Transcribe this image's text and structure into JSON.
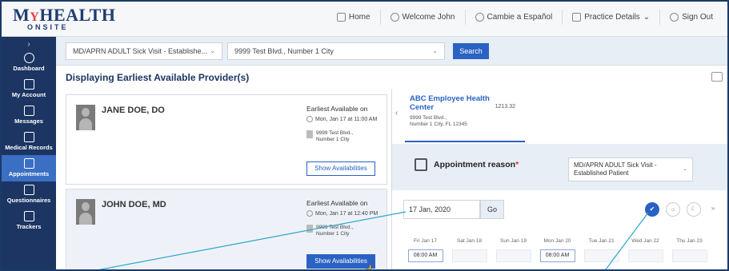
{
  "logo": {
    "main_m": "M",
    "main_y": "Y",
    "main_rest": "HEALTH",
    "sub": "ONSITE"
  },
  "nav": [
    {
      "label": "Home"
    },
    {
      "label": "Welcome John"
    },
    {
      "label": "Cambie a Español"
    },
    {
      "label": "Practice Details"
    },
    {
      "label": "Sign Out"
    }
  ],
  "sidebar": {
    "items": [
      {
        "label": "Dashboard"
      },
      {
        "label": "My Account"
      },
      {
        "label": "Messages"
      },
      {
        "label": "Medical Records"
      },
      {
        "label": "Appointments",
        "active": true
      },
      {
        "label": "Questionnaires"
      },
      {
        "label": "Trackers"
      }
    ]
  },
  "filters": {
    "visit_type": "MD/APRN ADULT Sick Visit - Establishe...",
    "location": "9999 Test Blvd., Number 1 City",
    "search_label": "Search"
  },
  "page_title": "Displaying Earliest Available Provider(s)",
  "providers": [
    {
      "name": "JANE DOE, DO",
      "ea_label": "Earliest Available on",
      "ea_date": "Mon, Jan 17 at 11:00 AM",
      "addr1": "9999 Test Blvd.,",
      "addr2": "Number 1 City",
      "button": "Show Availabilities"
    },
    {
      "name": "JOHN DOE, MD",
      "ea_label": "Earliest Available on",
      "ea_date": "Mon, Jan 17 at 12:40 PM",
      "addr1": "9999 Test Blvd.,",
      "addr2": "Number 1 City",
      "button": "Show Availabilities"
    }
  ],
  "location": {
    "name": "ABC Employee Health Center",
    "number": "1213.32",
    "addr1": "9999 Test Blvd.,",
    "addr2": "Number 1 City, FL 12345"
  },
  "reason": {
    "label": "Appointment reason",
    "required_mark": "*",
    "value_line1": "MD/APRN ADULT Sick Visit -",
    "value_line2": "Established Patient"
  },
  "date": {
    "value": "17 Jan, 2020",
    "go_label": "Go"
  },
  "days": [
    "Fri Jan 17",
    "Sat Jan 18",
    "Sun Jan 19",
    "Mon Jan 20",
    "Tue Jan 21",
    "Wed Jan 22",
    "Thu Jan 23"
  ],
  "slots": [
    "08:00 AM",
    "",
    "",
    "08:00 AM",
    "",
    "",
    ""
  ],
  "colors": {
    "brand_navy": "#1c3562",
    "accent_blue": "#2a62c4",
    "callout": "#2aa7c9"
  }
}
